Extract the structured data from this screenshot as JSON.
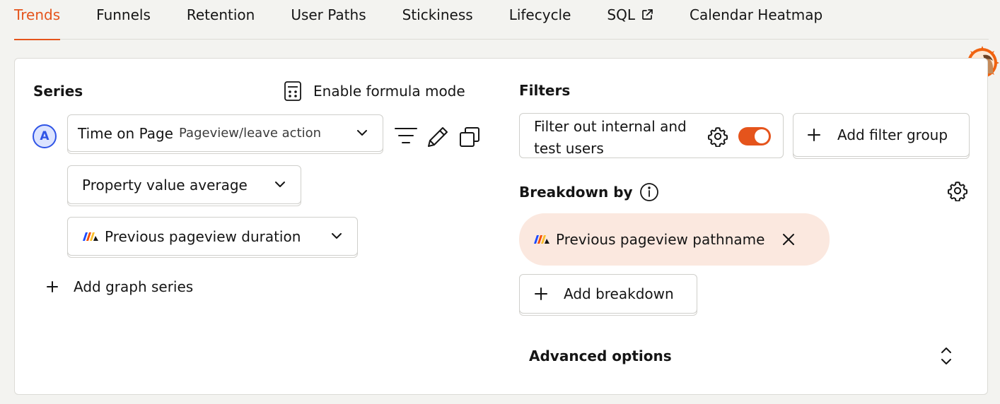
{
  "tabs": [
    {
      "label": "Trends",
      "active": true
    },
    {
      "label": "Funnels"
    },
    {
      "label": "Retention"
    },
    {
      "label": "User Paths"
    },
    {
      "label": "Stickiness"
    },
    {
      "label": "Lifecycle"
    },
    {
      "label": "SQL",
      "external": true
    },
    {
      "label": "Calendar Heatmap"
    }
  ],
  "series": {
    "title": "Series",
    "formula_label": "Enable formula mode",
    "badge": "A",
    "event": "Time on Page",
    "event_sub": "Pageview/leave action",
    "aggregation": "Property value average",
    "property": "Previous pageview duration",
    "add_label": "Add graph series"
  },
  "filters": {
    "title": "Filters",
    "internal_line1": "Filter out internal and",
    "internal_line2": "test users",
    "internal_enabled": true,
    "add_group_label": "Add filter group"
  },
  "breakdown": {
    "title": "Breakdown by",
    "chip_label": "Previous pageview pathname",
    "add_label": "Add breakdown"
  },
  "advanced": {
    "label": "Advanced options"
  },
  "colors": {
    "accent": "#e5541c",
    "series_badge": "#2f54e6",
    "chip_bg": "#fbe8df"
  },
  "icons": [
    "external-link-icon",
    "calculator-icon",
    "chevron-down-icon",
    "filter-icon",
    "pencil-icon",
    "copy-icon",
    "plus-icon",
    "gear-icon",
    "info-icon",
    "close-icon",
    "chevron-up-down-icon",
    "property-icon"
  ]
}
